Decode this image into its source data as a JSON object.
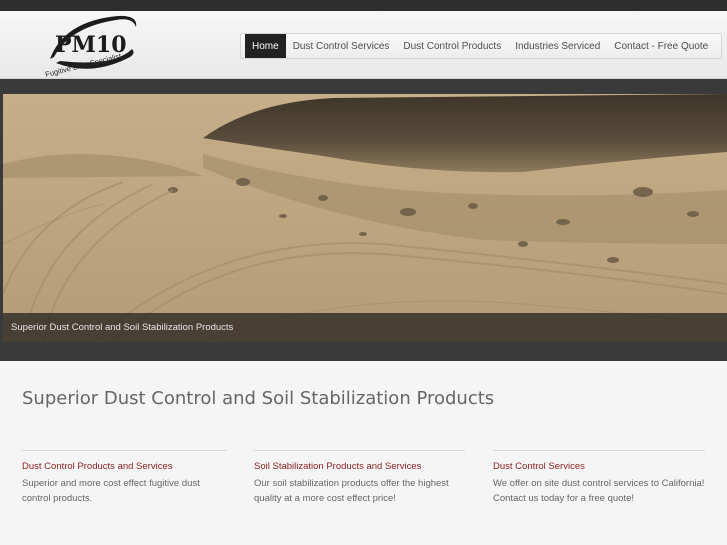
{
  "logo": {
    "text": "PM10",
    "tagline": "Fugitive Dust Specialist"
  },
  "nav": {
    "items": [
      {
        "label": "Home",
        "active": true
      },
      {
        "label": "Dust Control Services"
      },
      {
        "label": "Dust Control Products"
      },
      {
        "label": "Industries Serviced"
      },
      {
        "label": "Contact - Free Quote"
      }
    ]
  },
  "hero": {
    "caption": "Superior Dust Control and Soil Stabilization Products"
  },
  "main": {
    "title": "Superior Dust Control and Soil Stabilization Products",
    "columns": [
      {
        "title": "Dust Control Products and Services",
        "text": "Superior and more cost effect fugitive dust control products."
      },
      {
        "title": "Soil Stabilization Products and Services",
        "text": "Our soil stabilization products offer the highest quality at a more cost effect price!"
      },
      {
        "title": "Dust Control Services",
        "text": "We offer on site dust control services to California! Contact us today for a free quote!"
      }
    ]
  },
  "colors": {
    "accent": "#8a1f1f",
    "nav_active": "#222222",
    "top_bar": "#2d2d2d"
  }
}
